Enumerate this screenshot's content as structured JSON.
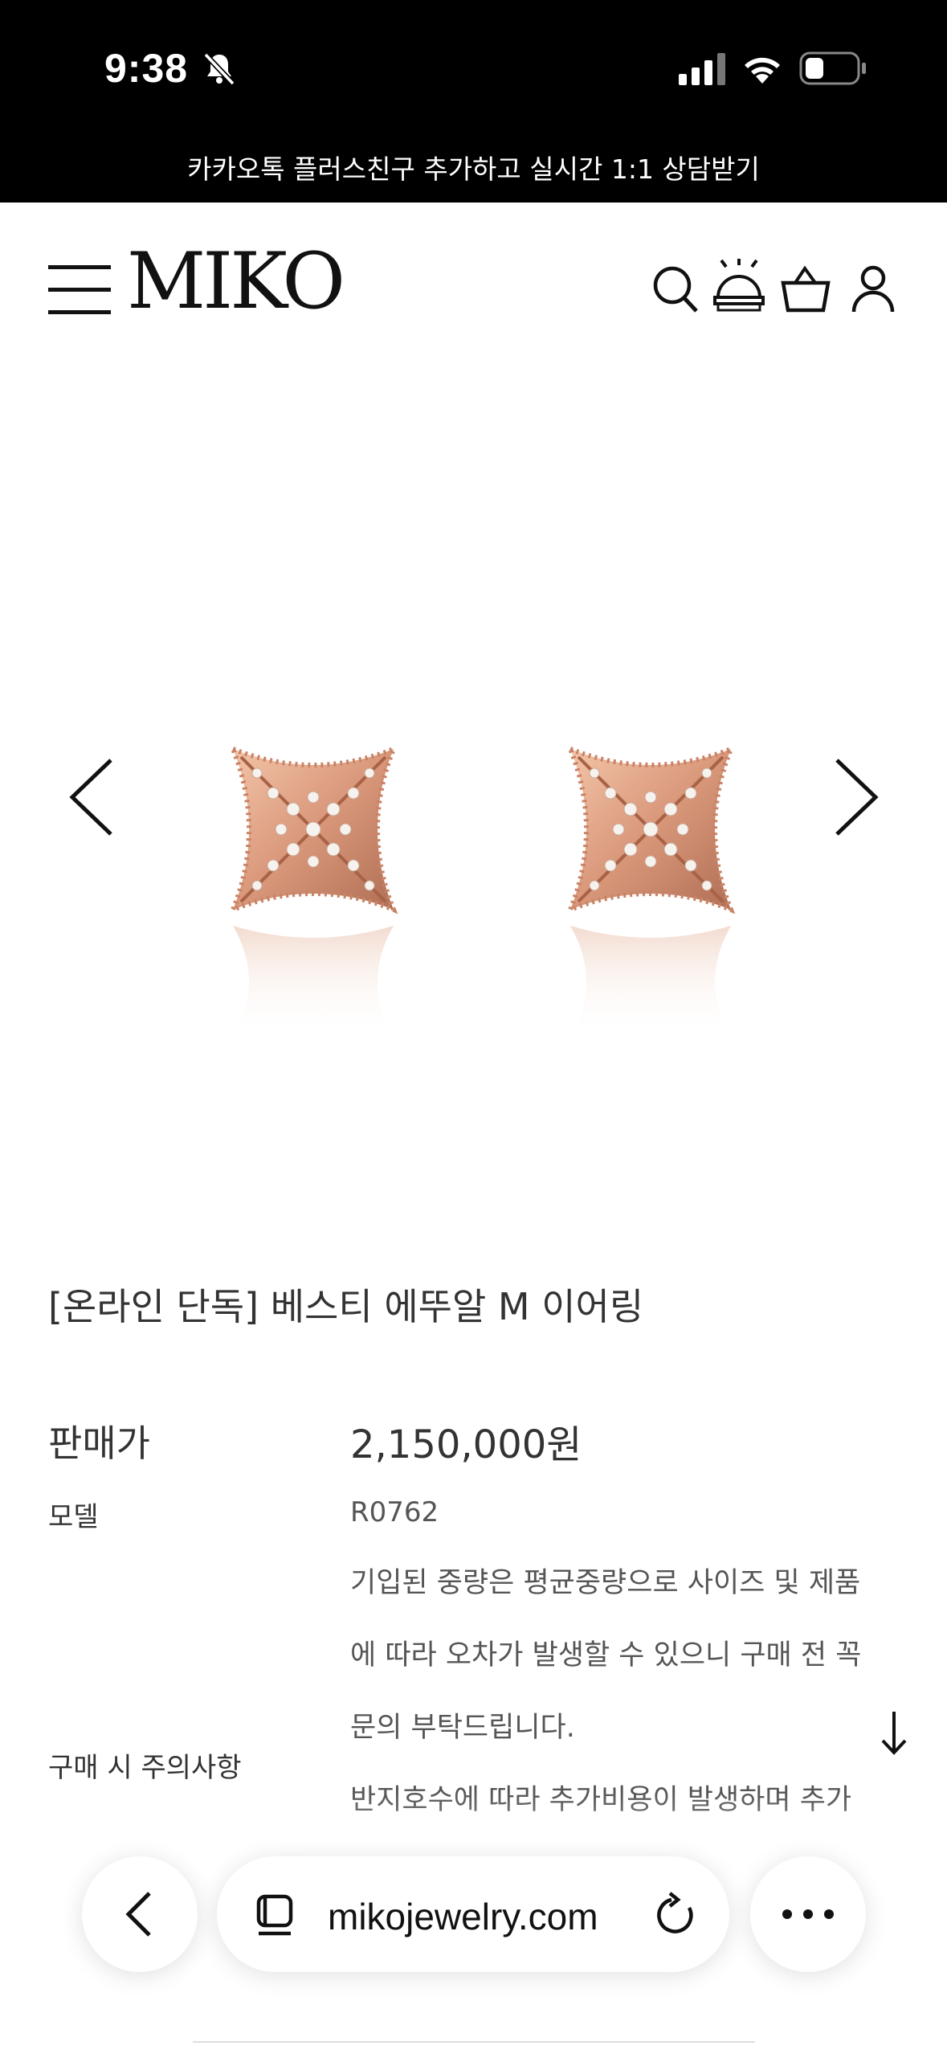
{
  "status_bar": {
    "time": "9:38"
  },
  "banner": {
    "text": "카카오톡 플러스친구 추가하고 실시간 1:1 상담받기"
  },
  "header": {
    "logo": "MIKO"
  },
  "product": {
    "title": "[온라인 단독] 베스티 에뚜알 M 이어링",
    "price_label": "판매가",
    "price": "2,150,000원",
    "model_label": "모델",
    "model": "R0762",
    "notice_label": "구매 시 주의사항",
    "notice_lines": [
      "기입된 중량은 평균중량으로 사이즈 및 제품",
      "에 따라 오차가 발생할 수 있으니 구매 전 꼭",
      "문의 부탁드립니다.",
      "반지호수에 따라 추가비용이 발생하며 추가"
    ]
  },
  "browser": {
    "url": "mikojewelry.com"
  },
  "colors": {
    "rose_gold": "#d9977a",
    "black": "#000000"
  }
}
